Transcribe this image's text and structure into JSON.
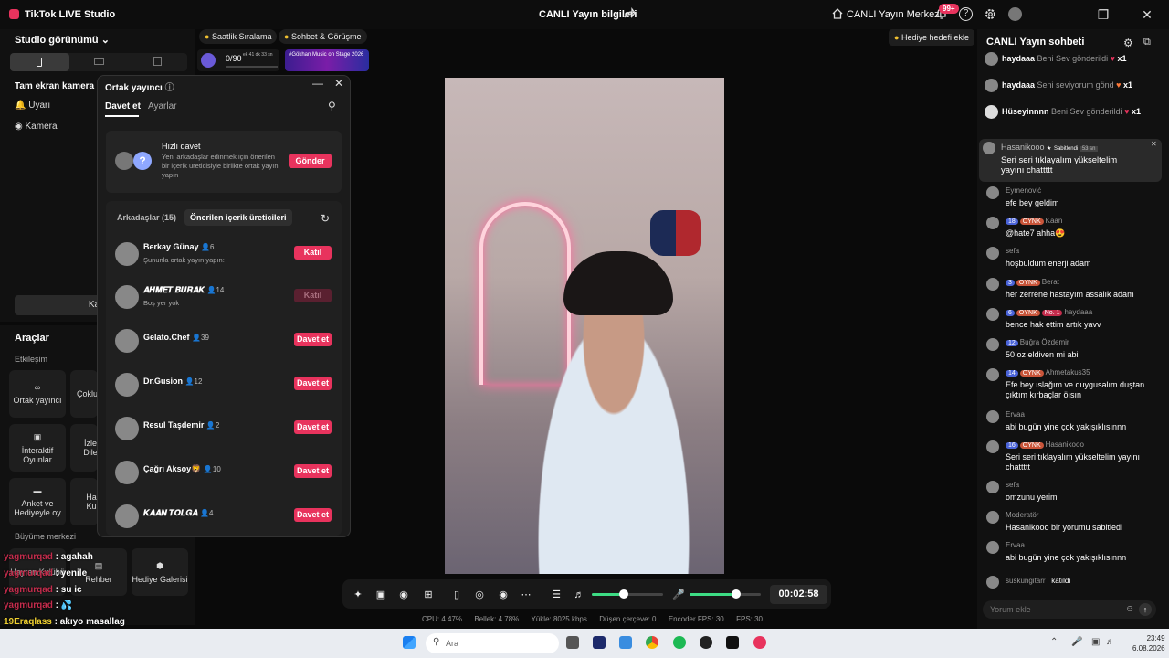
{
  "titlebar": {
    "app_name": "TikTok LIVE Studio",
    "stream_info": "CANLI Yayın bilgileri",
    "center_link": "CANLI Yayın Merkezi",
    "notif_count": "99+",
    "help": "?"
  },
  "leftpanel": {
    "studio_view": "Studio görünümü",
    "fullscreen": "Tam ekran kamera",
    "sources": [
      "Uyarı",
      "Kamera"
    ],
    "add_source": "Kayna"
  },
  "tools": {
    "title": "Araçlar",
    "section_engagement": "Etkileşim",
    "section_growth": "Büyüme merkezi",
    "cards": [
      "Ortak yayıncı",
      "Çoklu",
      "İnteraktif Oyunlar",
      "İzle Dile",
      "Anket ve Hediyeyle oy",
      "Ha Ku",
      "Hayran Kulübü",
      "Rehber",
      "Hediye Galerisi"
    ]
  },
  "overlay_chat": [
    {
      "user": "yagmurqad",
      "text": " : agahah"
    },
    {
      "user": "yagmurqad",
      "text": " : yenile"
    },
    {
      "user": "yagmurqad",
      "text": " : su ic"
    },
    {
      "user": "yagmurqad",
      "text": " : 💦"
    },
    {
      "user": "19Eraqlass",
      "text": " : akıyo masallag"
    }
  ],
  "stream": {
    "pill_hourly": "Saatlik Sıralama",
    "pill_chat": "Sohbet & Görüşme",
    "progress": "0/90",
    "progress_time": "ek 41 dk 33 sn",
    "progress_fraction": 0.0,
    "promo": "#Gökhan Music on Stage 2026",
    "gift_goal": "Hediye hedefi ekle"
  },
  "controls": {
    "timer": "00:02:58",
    "volume_fraction": 0.45,
    "mic_fraction": 0.65
  },
  "status": {
    "cpu": "CPU: 4.47%",
    "mem": "Bellek: 4.78%",
    "upload": "Yükle: 8025 kbps",
    "dropped": "Düşen çerçeve: 0",
    "enc_fps": "Encoder FPS: 30",
    "fps": "FPS: 30"
  },
  "modal": {
    "title": "Ortak yayıncı",
    "tab_invite": "Davet et",
    "tab_settings": "Ayarlar",
    "quick_title": "Hızlı davet",
    "quick_desc": "Yeni arkadaşlar edinmek için önerilen bir içerik üreticisiyle birlikte ortak yayın yapın",
    "send": "Gönder",
    "friends_tab": "Arkadaşlar (15)",
    "suggest_tab": "Önerilen içerik üreticileri",
    "creators": [
      {
        "name": "Berkay Günay",
        "count": "6",
        "sub": "Şununla ortak yayın yapın:",
        "btn": "Katıl",
        "disabled": false
      },
      {
        "name": "𝑨𝑯𝑴𝑬𝑻 𝑩𝑼𝑹𝑨𝑲",
        "count": "14",
        "sub": "Boş yer yok",
        "btn": "Katıl",
        "disabled": true
      },
      {
        "name": "Gelato.Chef",
        "count": "39",
        "sub": "",
        "btn": "Davet et",
        "disabled": false
      },
      {
        "name": "Dr.Gusion",
        "count": "12",
        "sub": "",
        "btn": "Davet et",
        "disabled": false
      },
      {
        "name": "Resul Taşdemir",
        "count": "2",
        "sub": "",
        "btn": "Davet et",
        "disabled": false
      },
      {
        "name": "Çağrı Aksoy🦁",
        "count": "10",
        "sub": "",
        "btn": "Davet et",
        "disabled": false
      },
      {
        "name": "𝑲𝑨𝑨𝑵 𝑻𝑶𝑳𝑮𝑨",
        "count": "4",
        "sub": "",
        "btn": "Davet et",
        "disabled": false
      }
    ]
  },
  "chat": {
    "title": "CANLI Yayın sohbeti",
    "gifts": [
      {
        "user": "haydaaa",
        "text": "Beni Sev gönderildi",
        "mult": "x1"
      },
      {
        "user": "haydaaa",
        "text": "Seni seviyorum gönd",
        "mult": "x1"
      },
      {
        "user": "Hüseyinnnn",
        "text": "Beni Sev gönderildi",
        "mult": "x1"
      }
    ],
    "pinned": {
      "user": "Hasanikooo",
      "label": "Sabitlendi",
      "time": "53 sn",
      "text": "Seri seri tıklayalım yükseltelim yayını chattttt"
    },
    "messages": [
      {
        "user": "Eymenoviċ",
        "tags": [],
        "text": "efe bey geldim"
      },
      {
        "user": "Kaan",
        "tags": [
          "18",
          "OYNK"
        ],
        "text": "@hate7 ahha😍"
      },
      {
        "user": "sefa",
        "tags": [],
        "text": "hoşbuldum enerji adam"
      },
      {
        "user": "Berat",
        "tags": [
          "3",
          "OYNK"
        ],
        "text": "her zerrene hastayım assalık adam"
      },
      {
        "user": "haydaaa",
        "tags": [
          "6",
          "OYNK",
          "No. 1"
        ],
        "text": "bence hak ettim artık yavv"
      },
      {
        "user": "Buğra Özdemir",
        "tags": [
          "12"
        ],
        "text": "50 oz eldiven mi abi"
      },
      {
        "user": "Ahmetakus35",
        "tags": [
          "14",
          "OYNK"
        ],
        "text": "Efe bey ıslağım ve duygusalım duştan çıktım kırbaçlar öısın"
      },
      {
        "user": "Ervaa",
        "tags": [],
        "text": "abi bugün yine çok yakışıklısınnn"
      },
      {
        "user": "Hasanikooo",
        "tags": [
          "16",
          "OYNK"
        ],
        "text": "Seri seri tıklayalım yükseltelim yayını chattttt"
      },
      {
        "user": "sefa",
        "tags": [],
        "text": "omzunu yerim"
      },
      {
        "user": "Moderatör",
        "tags": [],
        "text": "Hasanikooo bir yorumu sabitledi"
      },
      {
        "user": "Ervaa",
        "tags": [],
        "text": "abi bugün yine çok yakışıklısınnn"
      }
    ],
    "join": {
      "user": "suskungitarr",
      "text": "katıldı"
    },
    "comment_placeholder": "Yorum ekle"
  },
  "taskbar": {
    "search": "Ara",
    "time": "23:49",
    "date": "6.08.2026"
  }
}
